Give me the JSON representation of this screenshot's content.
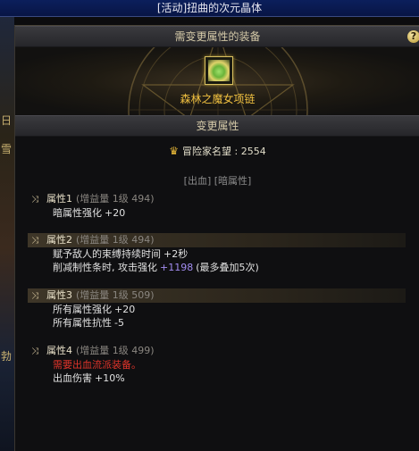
{
  "window": {
    "title": "[活动]扭曲的次元晶体"
  },
  "scene": {
    "glyphs": [
      "日",
      "雪",
      "勃"
    ]
  },
  "panel": {
    "equip_header": "需变更属性的装备",
    "help_label": "?",
    "item": {
      "name": "森林之魔女项链",
      "icon": "necklace-icon"
    },
    "change_header": "变更属性",
    "fame": {
      "icon": "crown-icon",
      "label": "冒险家名望",
      "value": "2554"
    },
    "tags": "[出血] [暗属性]"
  },
  "attributes": [
    {
      "name": "属性1",
      "amp": "(增益量 1级 494)",
      "highlighted": false,
      "lines": [
        {
          "pre": "暗属性强化",
          "val": "+20"
        }
      ]
    },
    {
      "name": "属性2",
      "amp": "(增益量 1级 494)",
      "highlighted": true,
      "lines": [
        {
          "pre": "赋予敌人的束缚持续时间",
          "val": "+2秒"
        },
        {
          "pre": "削减制性条时, 攻击强化",
          "val_hl": "+1198",
          "post": "(最多叠加5次)"
        }
      ]
    },
    {
      "name": "属性3",
      "amp": "(增益量 1级 509)",
      "highlighted": true,
      "lines": [
        {
          "pre": "所有属性强化",
          "val": "+20"
        },
        {
          "pre": "所有属性抗性",
          "val": "-5"
        }
      ]
    },
    {
      "name": "属性4",
      "amp": "(增益量 1级 499)",
      "highlighted": false,
      "lines": [
        {
          "pre": "需要出血流派装备。",
          "warn": true
        },
        {
          "pre": "出血伤害",
          "val": "+10%"
        }
      ]
    }
  ],
  "colors": {
    "item_name": "#f0c040",
    "warning": "#e0342a",
    "highlight_value": "#a28cf0",
    "header_text": "#d4c9a8"
  }
}
